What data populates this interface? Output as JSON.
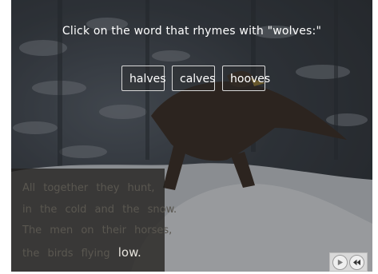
{
  "question": {
    "prompt": "Click on the word that rhymes with \"wolves:\""
  },
  "choices": [
    {
      "label": "halves"
    },
    {
      "label": "calves"
    },
    {
      "label": "hooves"
    }
  ],
  "poem": {
    "lines": [
      "All together they hunt,",
      "in the cold and the snow.",
      "The men on their horses,"
    ],
    "last_line_prefix": "the birds flying",
    "last_line_highlight": "low."
  },
  "navigation": {
    "play_icon": "play-icon",
    "back_icon": "rewind-icon"
  },
  "colors": {
    "prompt_text": "#ffffff",
    "choice_border": "#d8d8d8",
    "poem_text": "#5a5750",
    "poem_highlight": "#e6e3dc"
  }
}
